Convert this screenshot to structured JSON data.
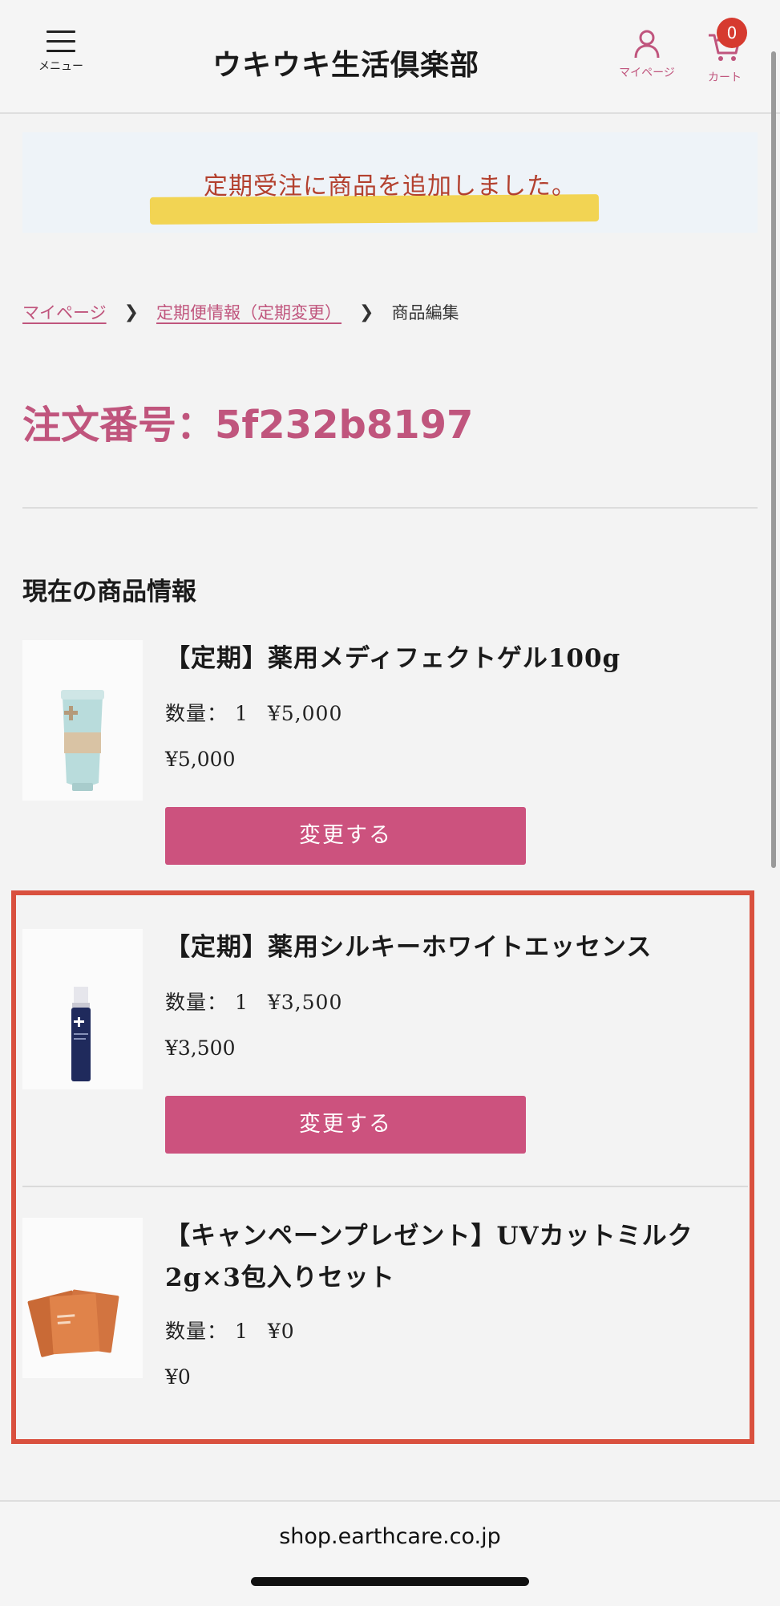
{
  "header": {
    "menu_label": "メニュー",
    "site_title": "ウキウキ生活倶楽部",
    "mypage_label": "マイページ",
    "cart_label": "カート",
    "cart_count": "0"
  },
  "notice": {
    "message": "定期受注に商品を追加しました。"
  },
  "breadcrumb": {
    "items": [
      "マイページ",
      "定期便情報（定期変更）",
      "商品編集"
    ]
  },
  "order": {
    "number_text": "注文番号：5f232b8197"
  },
  "section_title": "現在の商品情報",
  "products": [
    {
      "name": "【定期】薬用メディフェクトゲル100g",
      "qty_label": "数量：",
      "qty": "1",
      "unit_price": "¥5,000",
      "total": "¥5,000",
      "button_label": "変更する"
    },
    {
      "name": "【定期】薬用シルキーホワイトエッセンス",
      "qty_label": "数量：",
      "qty": "1",
      "unit_price": "¥3,500",
      "total": "¥3,500",
      "button_label": "変更する"
    },
    {
      "name_line1": "【キャンペーンプレゼント】UVカットミルク",
      "name_line2": "2g×3包入りセット",
      "qty_label": "数量：",
      "qty": "1",
      "unit_price": "¥0",
      "total": "¥0"
    }
  ],
  "footer": {
    "url": "shop.earthcare.co.jp"
  },
  "colors": {
    "accent": "#c0557d",
    "button": "#cc527e",
    "notice_text": "#b3402e",
    "highlight": "#f1d24a",
    "box_border": "#d9503e"
  }
}
